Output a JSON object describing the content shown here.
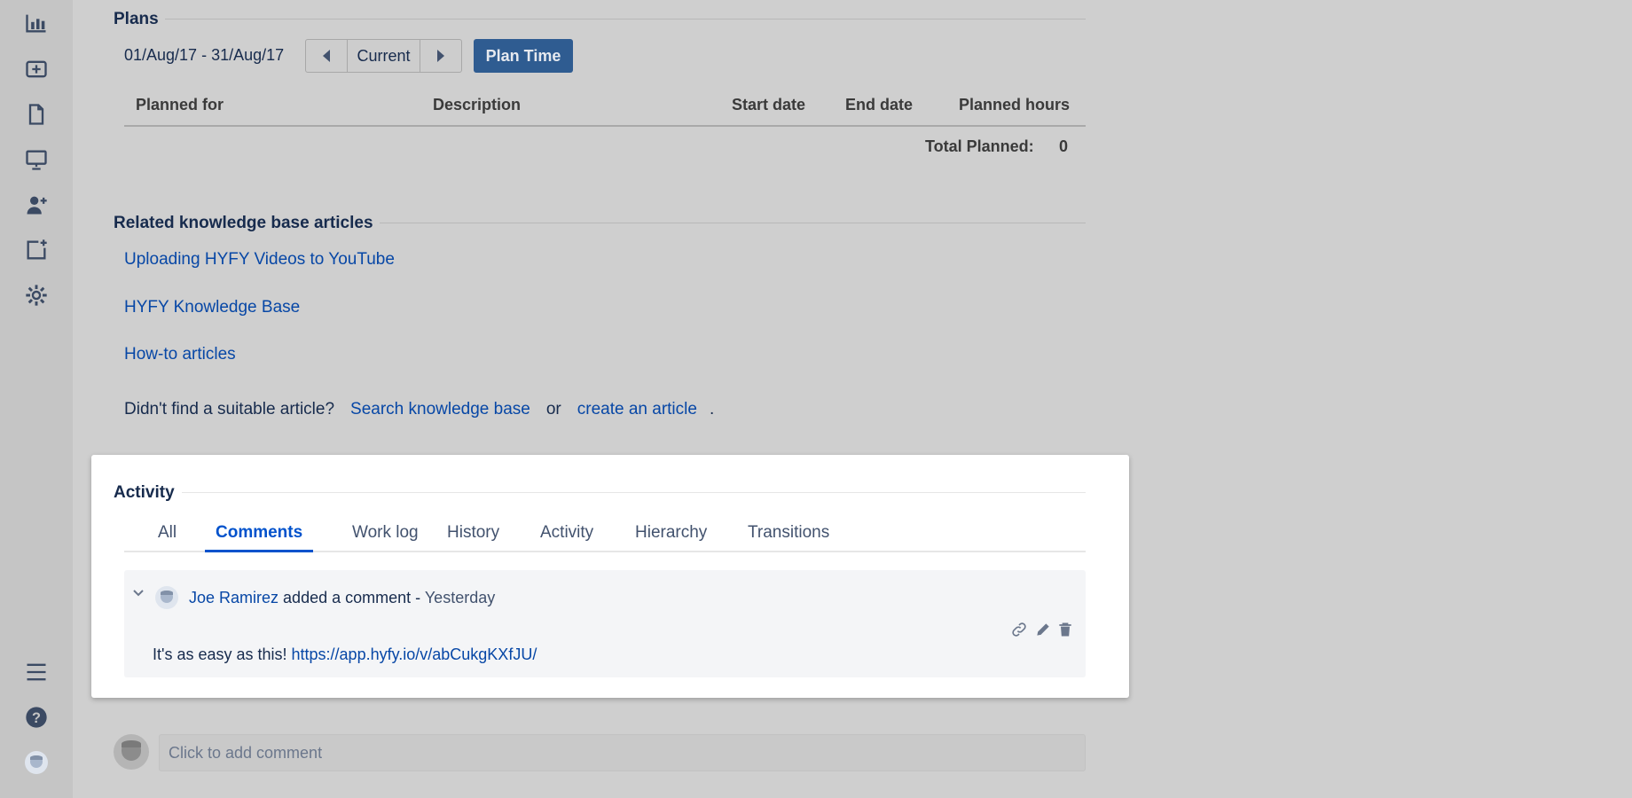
{
  "sidebar": {
    "items": [
      {
        "icon": "bar-chart-icon"
      },
      {
        "icon": "add-box-icon"
      },
      {
        "icon": "document-icon"
      },
      {
        "icon": "monitor-icon"
      },
      {
        "icon": "add-user-icon"
      },
      {
        "icon": "new-page-icon"
      },
      {
        "icon": "gear-icon"
      }
    ],
    "bottom": [
      {
        "icon": "menu-icon"
      },
      {
        "icon": "help-icon"
      },
      {
        "icon": "avatar-icon"
      }
    ]
  },
  "plans": {
    "heading": "Plans",
    "date_range": "01/Aug/17 - 31/Aug/17",
    "current_label": "Current",
    "plan_time_label": "Plan Time",
    "columns": [
      "Planned for",
      "Description",
      "Start date",
      "End date",
      "Planned hours"
    ],
    "total_label": "Total Planned:",
    "total_value": "0"
  },
  "kb": {
    "heading": "Related knowledge base articles",
    "articles": [
      "Uploading HYFY Videos to YouTube",
      "HYFY Knowledge Base",
      "How-to articles"
    ],
    "footer_text": "Didn't find a suitable article?",
    "search_link": "Search knowledge base",
    "or_text": "or",
    "create_link": "create an article",
    "period": "."
  },
  "activity": {
    "heading": "Activity",
    "tabs": [
      "All",
      "Comments",
      "Work log",
      "History",
      "Activity",
      "Hierarchy",
      "Transitions"
    ],
    "active_tab": "Comments",
    "comment": {
      "author": "Joe Ramirez",
      "action": "added a comment -",
      "time": "Yesterday",
      "text": "It's as easy as this!",
      "url": "https://app.hyfy.io/v/abCukgKXfJU/"
    },
    "add_placeholder": "Click to add comment"
  },
  "colors": {
    "link": "#0747a6",
    "primary_button": "#2f5c91",
    "active_tab": "#0052cc"
  }
}
